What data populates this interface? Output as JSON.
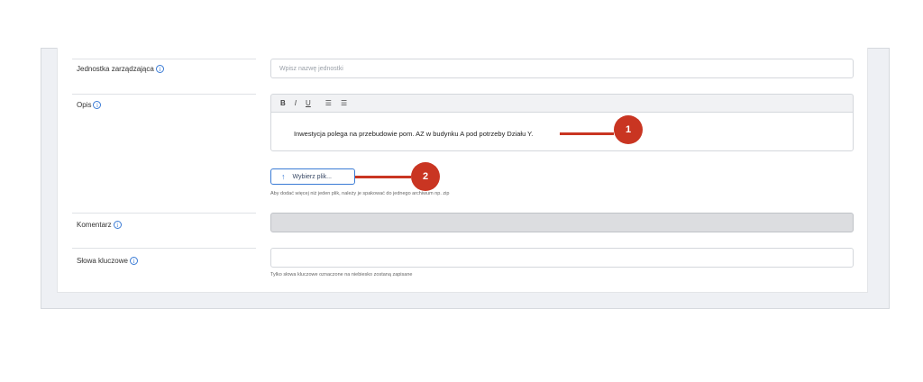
{
  "fields": {
    "jednostka": {
      "label": "Jednostka zarządzająca",
      "placeholder": "Wpisz nazwę jednostki"
    },
    "opis": {
      "label": "Opis",
      "toolbar": {
        "bold": "B",
        "italic": "I",
        "underline": "U",
        "ordered_list": "☰",
        "bullet_list": "☰"
      },
      "text": "Inwestycja polega na przebudowie pom. AZ w budynku A pod potrzeby Działu Y."
    },
    "upload": {
      "label": "Wybierz plik...",
      "hint": "Aby dodać więcej niż jeden plik, należy je spakować do jednego archiwum np. zip"
    },
    "komentarz": {
      "label": "Komentarz"
    },
    "slowa": {
      "label": "Słowa kluczowe",
      "hint": "Tylko słowa kluczowe oznaczone na niebiesko zostaną zapisane"
    }
  },
  "info_glyph": "i",
  "annotations": {
    "marker1": "1",
    "marker2": "2"
  },
  "colors": {
    "accent": "#3a7bd5",
    "annotation": "#c93522"
  }
}
